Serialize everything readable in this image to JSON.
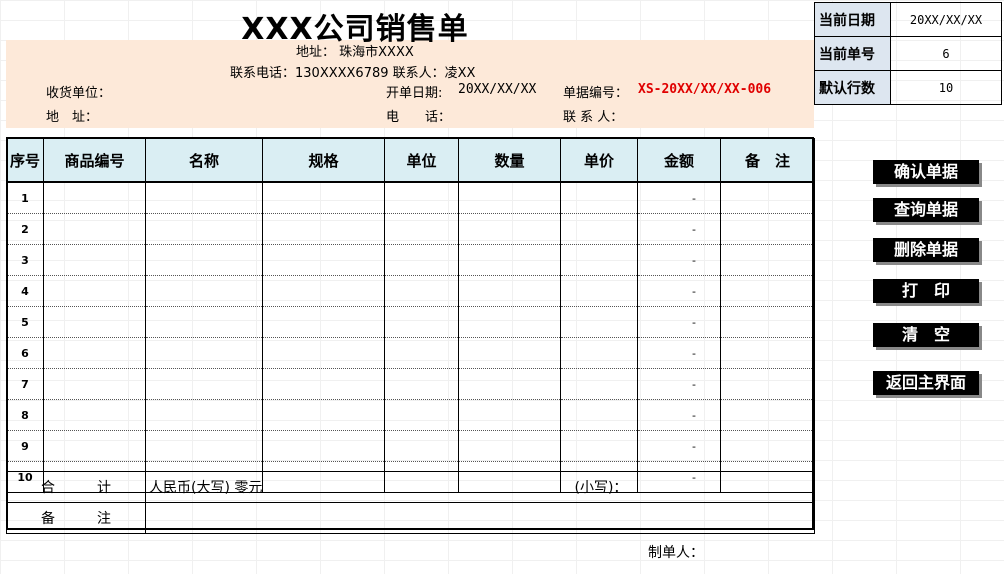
{
  "title": "XXX公司销售单",
  "address_line": "地址： 珠海市XXXX",
  "contact_line": "联系电话：130XXXX6789  联系人：凌XX",
  "receiver_label": "收货单位：",
  "open_date_label": "开单日期:",
  "open_date_value": "20XX/XX/XX",
  "doc_no_label": "单据编号：",
  "doc_no_value": "XS-20XX/XX/XX-006",
  "addr_label": "地　址：",
  "phone_label": "电　　话：",
  "contact_label": "联 系 人：",
  "info_panel": [
    {
      "label": "当前日期",
      "value": "20XX/XX/XX"
    },
    {
      "label": "当前单号",
      "value": "6"
    },
    {
      "label": "默认行数",
      "value": "10"
    }
  ],
  "columns": [
    "序号",
    "商品编号",
    "名称",
    "规格",
    "单位",
    "数量",
    "单价",
    "金额",
    "备　注"
  ],
  "rows": [
    {
      "no": "1",
      "amount": "-"
    },
    {
      "no": "2",
      "amount": "-"
    },
    {
      "no": "3",
      "amount": "-"
    },
    {
      "no": "4",
      "amount": "-"
    },
    {
      "no": "5",
      "amount": "-"
    },
    {
      "no": "6",
      "amount": "-"
    },
    {
      "no": "7",
      "amount": "-"
    },
    {
      "no": "8",
      "amount": "-"
    },
    {
      "no": "9",
      "amount": "-"
    },
    {
      "no": "10",
      "amount": "-"
    }
  ],
  "total_label": "合　　　计",
  "total_text": "人民币(大写) 零元",
  "small_label": "(小写)：",
  "remark_label": "备　　　注",
  "maker_label": "制单人：",
  "buttons": [
    "确认单据",
    "查询单据",
    "删除单据",
    "打　印",
    "清　空",
    "返回主界面"
  ]
}
